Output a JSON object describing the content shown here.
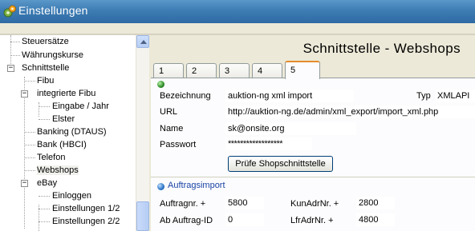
{
  "window": {
    "title": "Einstellungen",
    "app_icon": "settings-gear-icon"
  },
  "tree": {
    "items": [
      {
        "label": "Steuersätze"
      },
      {
        "label": "Währungskurse"
      },
      {
        "label": "Schnittstelle",
        "expander": "−"
      },
      {
        "label": "Fibu"
      },
      {
        "label": "integrierte Fibu",
        "expander": "−"
      },
      {
        "label": "Eingabe / Jahr"
      },
      {
        "label": "Elster"
      },
      {
        "label": "Banking (DTAUS)"
      },
      {
        "label": "Bank (HBCI)"
      },
      {
        "label": "Telefon"
      },
      {
        "label": "Webshops",
        "selected": true
      },
      {
        "label": "eBay",
        "expander": "−"
      },
      {
        "label": "Einloggen"
      },
      {
        "label": "Einstellungen 1/2"
      },
      {
        "label": "Einstellungen 2/2"
      }
    ]
  },
  "pane": {
    "title": "Schnittstelle - Webshops",
    "tabs": [
      "1",
      "2",
      "3",
      "4",
      "5"
    ],
    "active_tab": "5"
  },
  "form": {
    "bezeichnung_label": "Bezeichnung",
    "bezeichnung_value": "auktion-ng xml import",
    "typ_label": "Typ",
    "typ_value": "XMLAPI",
    "url_label": "URL",
    "url_value": "http://auktion-ng.de/admin/xml_export/import_xml.php",
    "name_label": "Name",
    "name_value": "sk@onsite.org",
    "passwort_label": "Passwort",
    "passwort_value": "******************",
    "check_button": "Prüfe Shopschnittstelle"
  },
  "auftragsimport": {
    "title": "Auftragsimport",
    "auftragnr_label": "Auftragnr. +",
    "auftragnr_value": "5800",
    "kunadrnr_label": "KunAdrNr. +",
    "kunadrnr_value": "2800",
    "ab_auftrag_label": "Ab Auftrag-ID",
    "ab_auftrag_value": "0",
    "lfradrnr_label": "LfrAdrNr. +",
    "lfradrnr_value": "4800"
  },
  "colors": {
    "titlebar": "#3d7cb4",
    "tab_active_accent": "#e68b2c",
    "group_title": "#1a44a5",
    "panel_bg": "#ece9d8"
  }
}
